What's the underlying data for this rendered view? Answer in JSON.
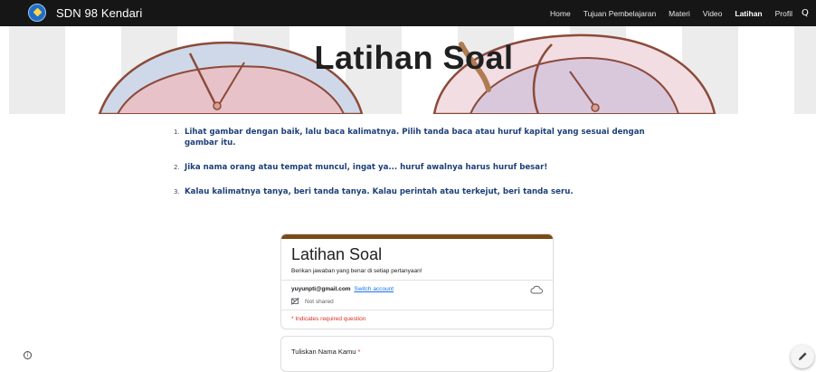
{
  "site": {
    "title": "SDN 98 Kendari"
  },
  "nav": {
    "items": [
      {
        "label": "Home",
        "active": false
      },
      {
        "label": "Tujuan Pembelajaran",
        "active": false
      },
      {
        "label": "Materi",
        "active": false
      },
      {
        "label": "Video",
        "active": false
      },
      {
        "label": "Latihan",
        "active": true
      },
      {
        "label": "Profil",
        "active": false
      }
    ],
    "search_glyph": "Q"
  },
  "hero": {
    "title": "Latihan Soal"
  },
  "instructions": [
    {
      "num": "1.",
      "text": "Lihat gambar dengan baik, lalu baca kalimatnya. Pilih tanda baca atau huruf kapital yang sesuai dengan gambar itu."
    },
    {
      "num": "2.",
      "text": "Jika nama orang atau tempat muncul, ingat ya... huruf awalnya harus huruf besar!"
    },
    {
      "num": "3.",
      "text": "Kalau kalimatnya tanya, beri tanda tanya. Kalau perintah atau terkejut, beri tanda seru."
    }
  ],
  "form": {
    "accent_color": "#7c4a17",
    "title": "Latihan Soal",
    "description": "Berikan jawaban yang benar di setiap pertanyaan!",
    "email": "yuyunpti@gmail.com",
    "switch_account": "Switch account",
    "not_shared": "Not shared",
    "required_note": "* Indicates required question",
    "question_label": "Tuliskan Nama Kamu",
    "required_star": "*"
  }
}
